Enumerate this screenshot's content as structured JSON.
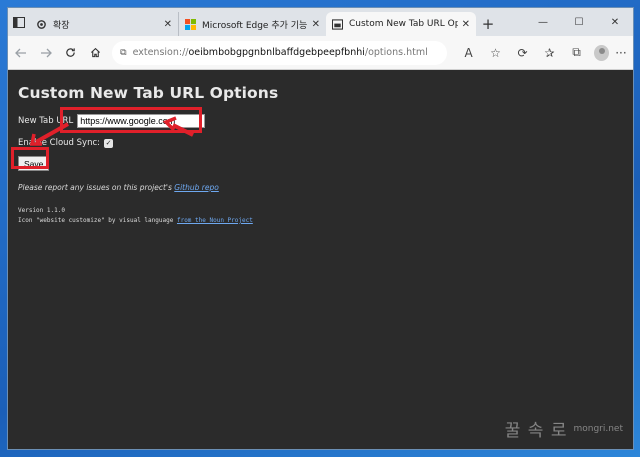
{
  "tabs": [
    {
      "title": "확장",
      "close": "✕",
      "active": false
    },
    {
      "title": "Microsoft Edge 추가 기능 - custom",
      "close": "✕",
      "active": false
    },
    {
      "title": "Custom New Tab URL Options",
      "close": "✕",
      "active": true
    }
  ],
  "new_tab_label": "+",
  "window_controls": {
    "minimize": "—",
    "maximize": "☐",
    "close": "✕"
  },
  "address": {
    "scheme": "extension://",
    "host": "oeibmbobgpgnbnlbaffdgebpeepfbnhi",
    "path": "/options.html"
  },
  "content": {
    "page_title": "Custom New Tab URL Options",
    "new_tab_label": "New Tab URL",
    "new_tab_value": "https://www.google.com",
    "sync_label": "Enable Cloud Sync:",
    "sync_checked": "✓",
    "save_label": "Save",
    "note_prefix": "Please report any issues on this project's",
    "note_link": "Github repo",
    "version": "Version 1.1.0",
    "credit_prefix": "Icon \"website customize\" by visual language",
    "credit_link": "from the Noun Project"
  },
  "watermark": {
    "text": "꿀 속 로",
    "url": "mongri.net"
  },
  "colors": {
    "annotation": "#e0202a",
    "link": "#6ea8f0",
    "page_bg": "#2b2b2b"
  }
}
